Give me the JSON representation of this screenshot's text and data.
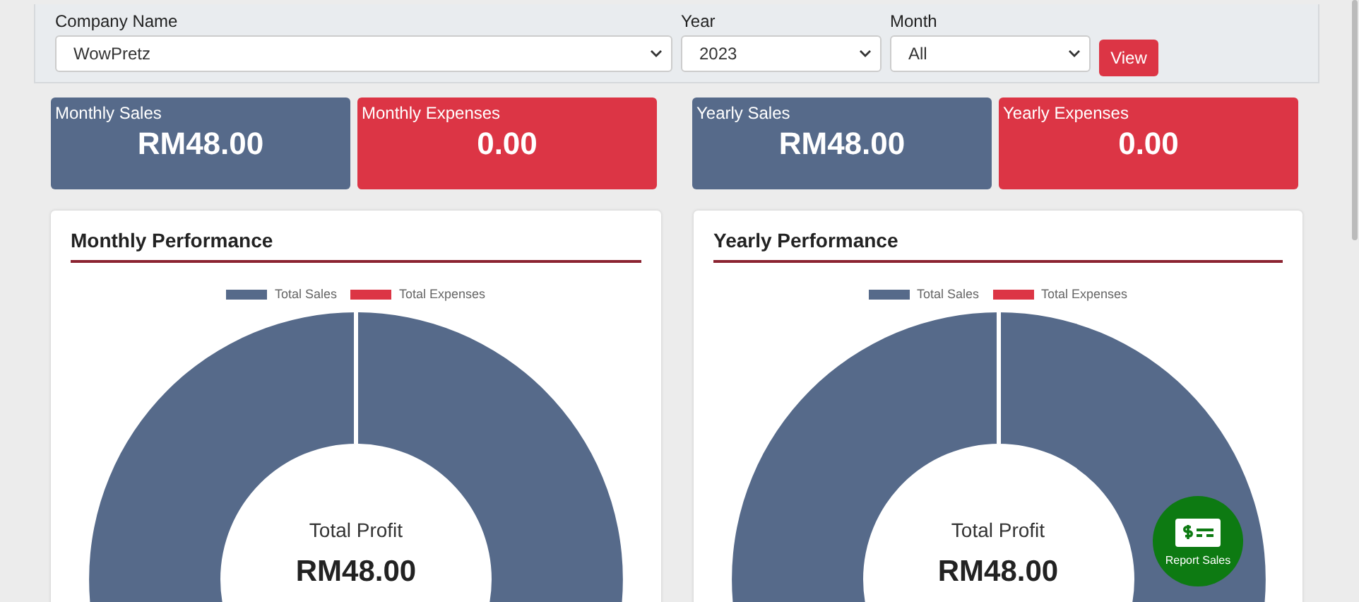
{
  "filters": [
    {
      "label": "Company Name",
      "value": "WowPretz"
    },
    {
      "label": "Year",
      "value": "2023"
    },
    {
      "label": "Month",
      "value": "All"
    }
  ],
  "view_button": "View",
  "summary_groups": [
    [
      {
        "label": "Monthly Sales",
        "value": "RM48.00",
        "kind": "sales"
      },
      {
        "label": "Monthly Expenses",
        "value": "0.00",
        "kind": "expenses"
      }
    ],
    [
      {
        "label": "Yearly Sales",
        "value": "RM48.00",
        "kind": "sales"
      },
      {
        "label": "Yearly Expenses",
        "value": "0.00",
        "kind": "expenses"
      }
    ]
  ],
  "panels": [
    {
      "title": "Monthly Performance",
      "center_label": "Total Profit",
      "center_value": "RM48.00",
      "legend": [
        {
          "label": "Total Sales",
          "color": "#566a8a"
        },
        {
          "label": "Total Expenses",
          "color": "#dc3545"
        }
      ]
    },
    {
      "title": "Yearly Performance",
      "center_label": "Total Profit",
      "center_value": "RM48.00",
      "legend": [
        {
          "label": "Total Sales",
          "color": "#566a8a"
        },
        {
          "label": "Total Expenses",
          "color": "#dc3545"
        }
      ]
    }
  ],
  "report_button": "Report Sales"
}
